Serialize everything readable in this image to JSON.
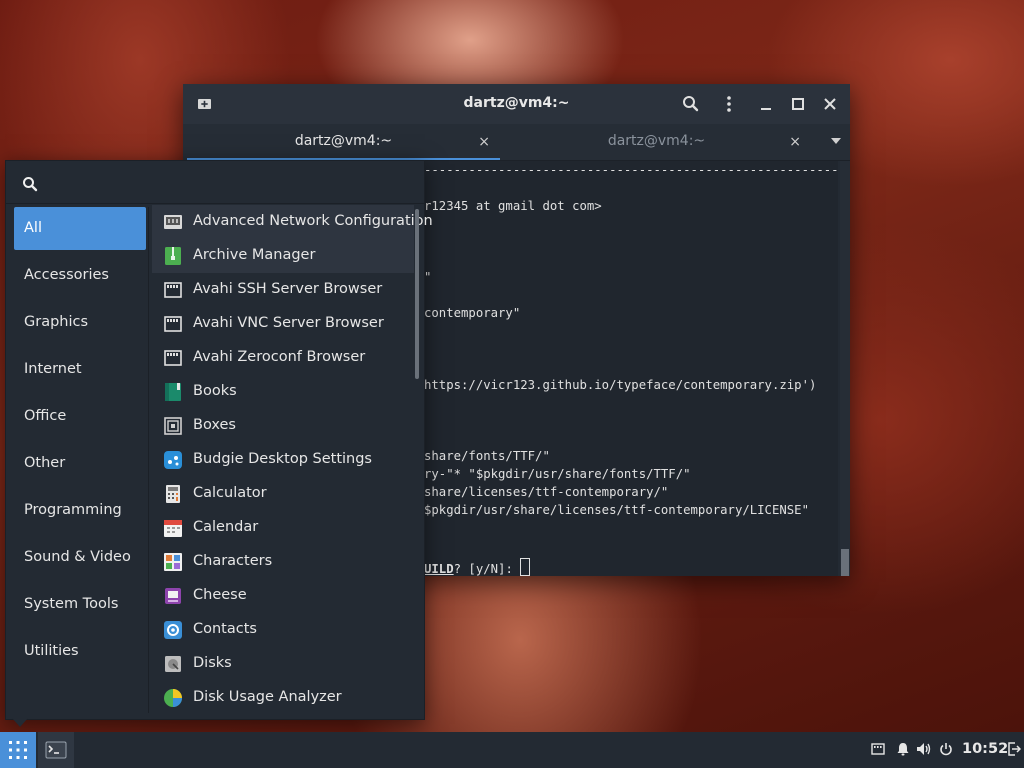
{
  "terminal": {
    "title": "dartz@vm4:~",
    "tabs": [
      {
        "label": "dartz@vm4:~",
        "close": "×"
      },
      {
        "label": "dartz@vm4:~",
        "close": "×"
      }
    ],
    "lines": [
      "----------------------------------------------------------",
      "r12345 at gmail dot com>",
      "\"",
      "contemporary\"",
      "https://vicr123.github.io/typeface/contemporary.zip')",
      "share/fonts/TTF/\"",
      "ry-\"* \"$pkgdir/usr/share/fonts/TTF/\"",
      "share/licenses/ttf-contemporary/\"",
      "$pkgdir/usr/share/licenses/ttf-contemporary/LICENSE\""
    ],
    "prompt_bold": "UILD",
    "prompt_rest": "? [y/N]: "
  },
  "menu": {
    "search_placeholder": "",
    "categories": [
      "All",
      "Accessories",
      "Graphics",
      "Internet",
      "Office",
      "Other",
      "Programming",
      "Sound & Video",
      "System Tools",
      "Utilities"
    ],
    "selected_category": "All",
    "apps": [
      {
        "label": "Advanced Network Configuration",
        "icon": "network-icon"
      },
      {
        "label": "Archive Manager",
        "icon": "archive-icon"
      },
      {
        "label": "Avahi SSH Server Browser",
        "icon": "network-browser-icon"
      },
      {
        "label": "Avahi VNC Server Browser",
        "icon": "network-browser-icon"
      },
      {
        "label": "Avahi Zeroconf Browser",
        "icon": "network-browser-icon"
      },
      {
        "label": "Books",
        "icon": "books-icon"
      },
      {
        "label": "Boxes",
        "icon": "boxes-icon"
      },
      {
        "label": "Budgie Desktop Settings",
        "icon": "budgie-settings-icon"
      },
      {
        "label": "Calculator",
        "icon": "calculator-icon"
      },
      {
        "label": "Calendar",
        "icon": "calendar-icon"
      },
      {
        "label": "Characters",
        "icon": "characters-icon"
      },
      {
        "label": "Cheese",
        "icon": "cheese-icon"
      },
      {
        "label": "Contacts",
        "icon": "contacts-icon"
      },
      {
        "label": "Disks",
        "icon": "disks-icon"
      },
      {
        "label": "Disk Usage Analyzer",
        "icon": "disk-usage-icon"
      }
    ]
  },
  "panel": {
    "clock": "10:52"
  },
  "colors": {
    "accent": "#4a90d9",
    "panel_bg": "#232a33"
  }
}
